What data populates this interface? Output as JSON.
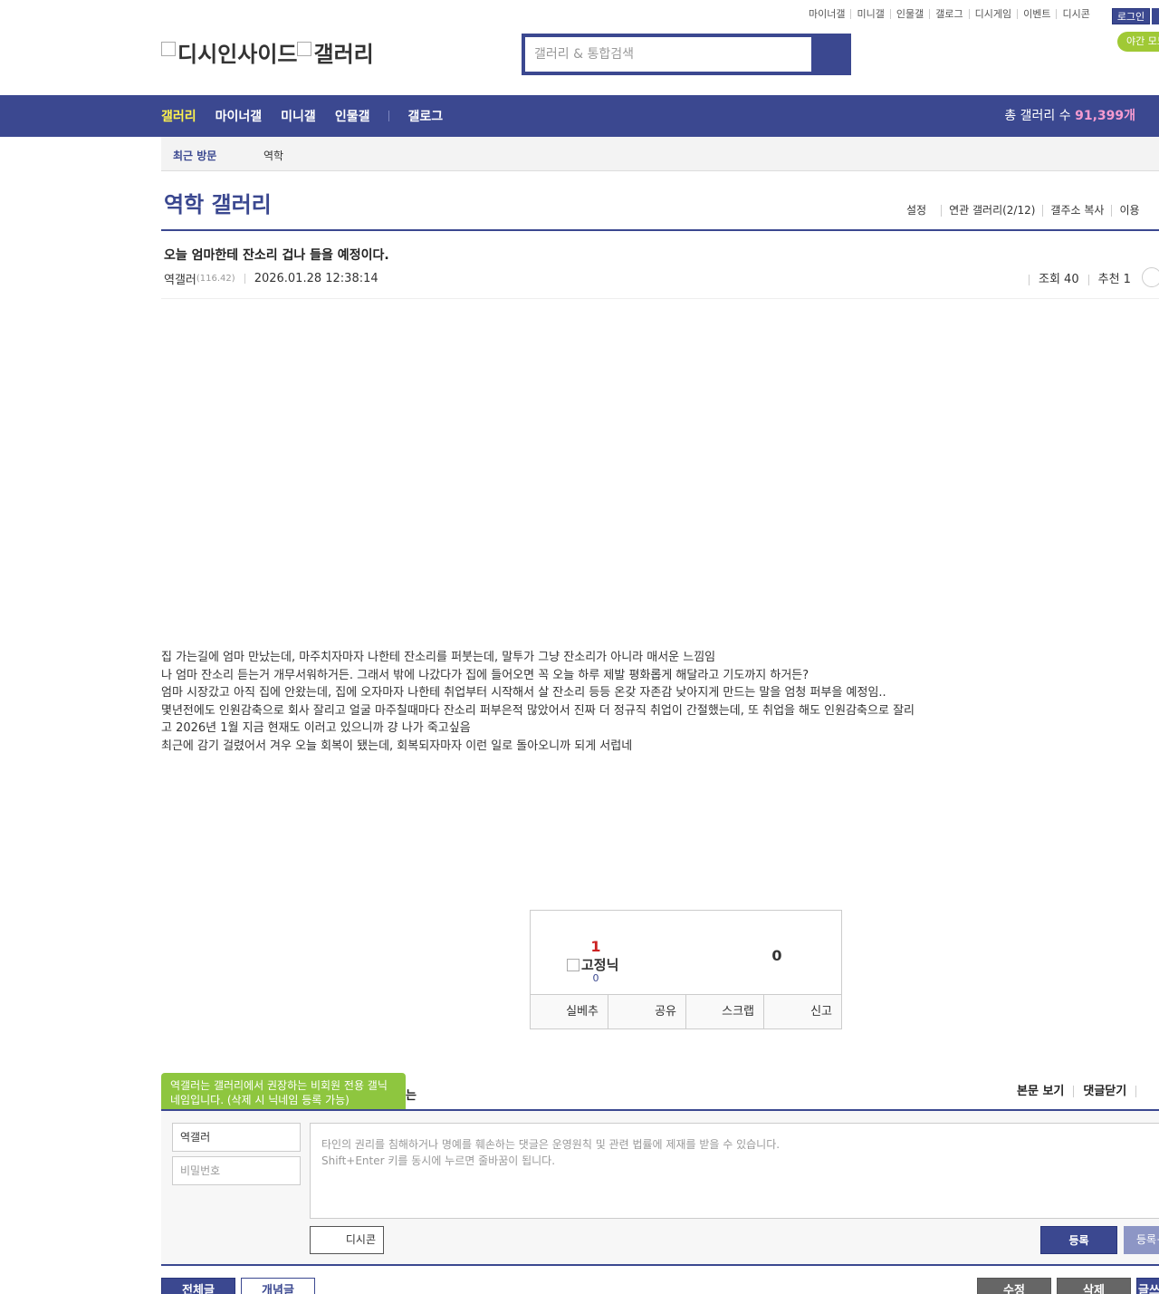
{
  "top_util": {
    "items": [
      "마이너갤",
      "미니갤",
      "인물갤",
      "갤로그",
      "디시게임",
      "이벤트",
      "디시콘"
    ],
    "login": "로그인",
    "night_mode": "야간 모드"
  },
  "logo": {
    "site": "디시인사이드",
    "gallery": "갤러리"
  },
  "search": {
    "placeholder": "갤러리 & 통합검색"
  },
  "gnb": {
    "items": [
      "갤러리",
      "마이너갤",
      "미니갤",
      "인물갤",
      "갤로그"
    ],
    "total_label": "총 갤러리 수",
    "total_value": "91,399개"
  },
  "recent": {
    "label": "최근 방문",
    "item": "역학"
  },
  "gallery": {
    "title": "역학 갤러리",
    "links": [
      "설정",
      "연관 갤러리(2/12)",
      "갤주소 복사",
      "이용"
    ]
  },
  "post": {
    "title": "오늘 엄마한테 잔소리 겁나 들을 예정이다.",
    "author": "역갤러",
    "ip": "(116.42)",
    "date": "2026.01.28 12:38:14",
    "views": "조회 40",
    "recommend": "추천 1",
    "body": [
      "집 가는길에 엄마 만났는데, 마주치자마자 나한테 잔소리를 퍼붓는데, 말투가 그냥 잔소리가 아니라 매서운 느낌임",
      "나 엄마 잔소리 듣는거 개무서워하거든. 그래서 밖에 나갔다가 집에 들어오면 꼭 오늘 하루 제발 평화롭게 해달라고 기도까지 하거든?",
      "엄마 시장갔고 아직 집에 안왔는데, 집에 오자마자 나한테 취업부터 시작해서 살 잔소리 등등 온갖 자존감 낮아지게 만드는 말을 엄청 퍼부을 예정임..",
      "몇년전에도 인원감축으로 회사 잘리고 얼굴 마주칠때마다 잔소리 퍼부은적 많았어서 진짜 더 정규직 취업이 간절했는데, 또 취업을 해도 인원감축으로 잘리",
      "고 2026년 1월 지금 현재도 이러고 있으니까 걍 나가 죽고싶음",
      "최근에 감기 걸렸어서 겨우 오늘 회복이 됐는데, 회복되자마자 이런 일로 돌아오니까 되게 서럽네"
    ]
  },
  "recommend_box": {
    "up_count": "1",
    "fixed_label": "고정닉",
    "fixed_count": "0",
    "down_count": "0",
    "buttons": [
      "실베추",
      "공유",
      "스크랩",
      "신고"
    ]
  },
  "comment": {
    "tooltip": "역갤러는 갤러리에서 권장하는 비회원 전용 갤닉네임입니다. (삭제 시 닉네임 등록 가능)",
    "header_hidden": "는",
    "header_links": [
      "본문 보기",
      "댓글닫기"
    ],
    "nick_value": "역갤러",
    "password_placeholder": "비밀번호",
    "textarea_line1": "타인의 권리를 침해하거나 명예를 훼손하는 댓글은 운영원칙 및 관련 법률에 제재를 받을 수 있습니다.",
    "textarea_line2": "Shift+Enter 키를 동시에 누르면 줄바꿈이 됩니다.",
    "dccon_label": "디시콘",
    "submit_label": "등록",
    "submit2_label": "등록+추천"
  },
  "bottom_buttons": {
    "all": "전체글",
    "best": "개념글",
    "edit": "수정",
    "delete": "삭제",
    "write": "글쓰기"
  },
  "colors": {
    "primary": "#3b4890",
    "accent_yellow": "#fff34d",
    "accent_green": "#8ec63f",
    "accent_pink": "#f59bd0",
    "recommend_red": "#cc2222"
  }
}
